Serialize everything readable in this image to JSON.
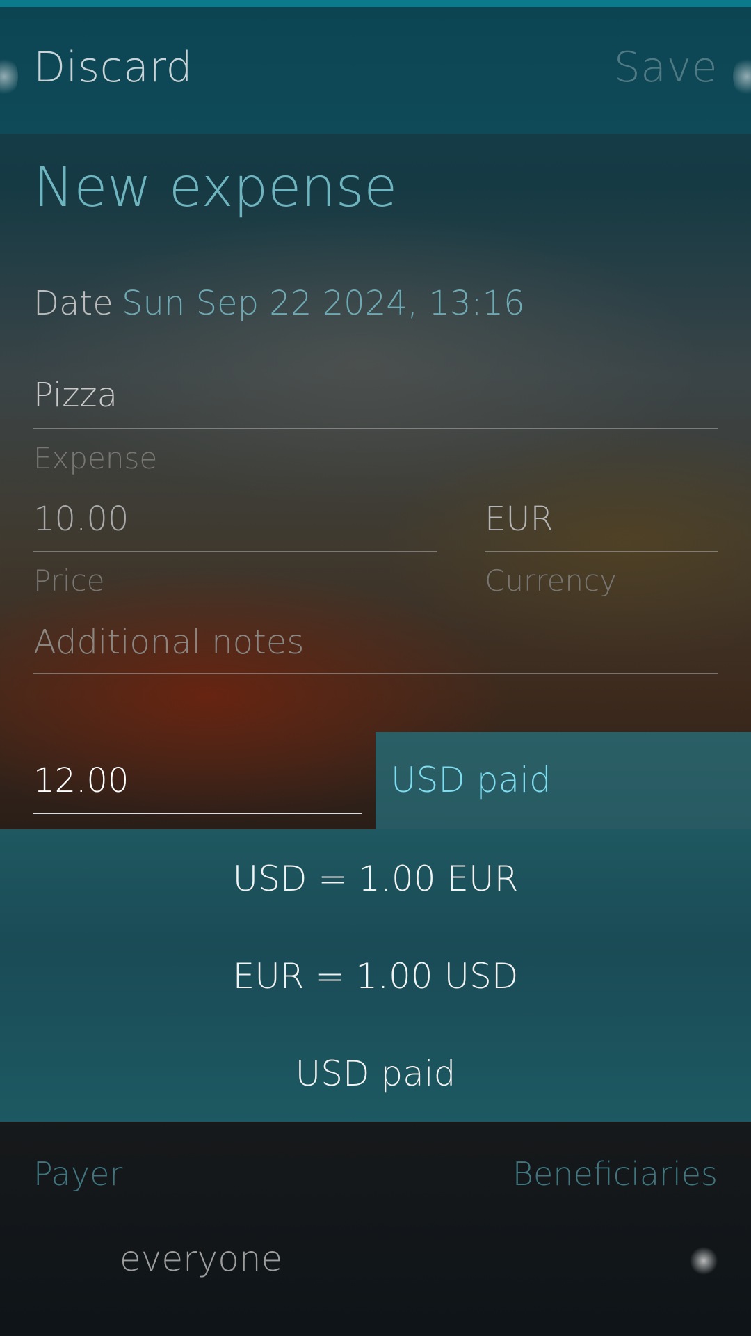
{
  "header": {
    "discard_label": "Discard",
    "save_label": "Save"
  },
  "page": {
    "title": "New expense"
  },
  "date": {
    "label": "Date",
    "value": "Sun Sep 22 2024, 13:16"
  },
  "expense": {
    "value": "Pizza",
    "label": "Expense"
  },
  "price": {
    "value": "10.00",
    "label": "Price"
  },
  "currency": {
    "value": "EUR",
    "label": "Currency"
  },
  "notes": {
    "placeholder": "Additional notes"
  },
  "conversion": {
    "amount_value": "12.00",
    "selected_mode": "USD paid",
    "options": [
      "USD = 1.00 EUR",
      "EUR = 1.00 USD",
      "USD paid"
    ]
  },
  "footer": {
    "payer_label": "Payer",
    "beneficiaries_label": "Beneficiaries",
    "everyone_label": "everyone"
  },
  "colors": {
    "accent": "#7fdcef",
    "title": "#6fb5c0",
    "popup_bg": "#1a4b56"
  }
}
